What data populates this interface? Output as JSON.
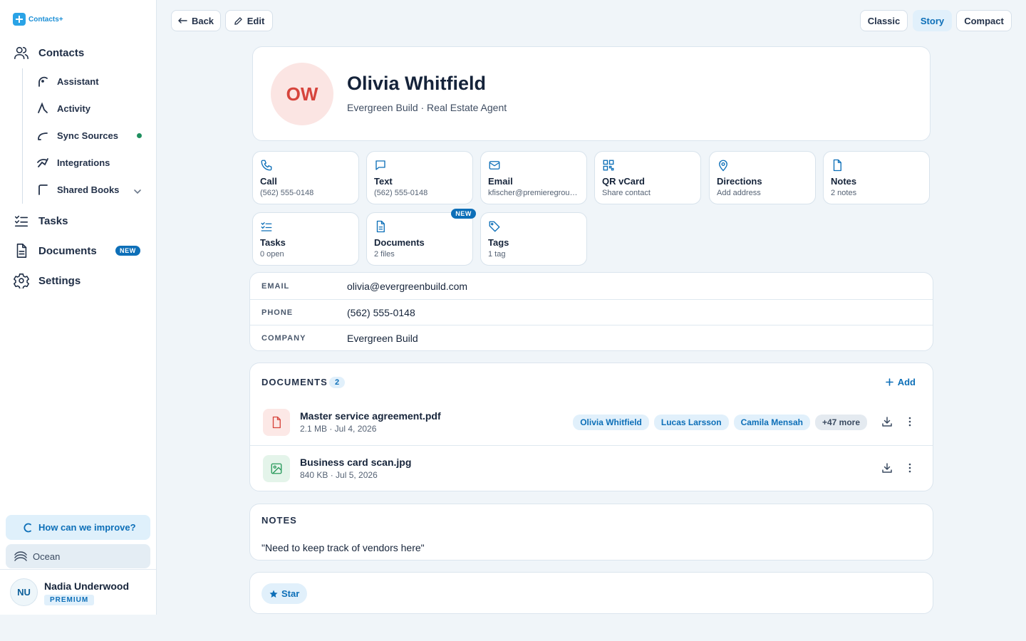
{
  "app": {
    "name": "Contacts+"
  },
  "sidebar": {
    "contacts": "Contacts",
    "sub_items": [
      {
        "label": "Assistant"
      },
      {
        "label": "Activity"
      },
      {
        "label": "Sync Sources"
      },
      {
        "label": "Integrations"
      },
      {
        "label": "Shared Books"
      }
    ],
    "tasks": "Tasks",
    "documents": "Documents",
    "documents_badge": "NEW",
    "settings": "Settings",
    "improve": "How can we improve?",
    "theme": "Ocean",
    "user": {
      "initials": "NU",
      "name": "Nadia Underwood",
      "plan": "PREMIUM"
    }
  },
  "toolbar": {
    "back": "Back",
    "edit": "Edit",
    "views": [
      "Classic",
      "Story",
      "Compact"
    ],
    "active_view": "Story"
  },
  "contact": {
    "initials": "OW",
    "name": "Olivia Whitfield",
    "subtitle": "Evergreen Build · Real Estate Agent"
  },
  "actions": [
    {
      "label": "Call",
      "sub": "(562) 555-0148",
      "icon": "phone-icon"
    },
    {
      "label": "Text",
      "sub": "(562) 555-0148",
      "icon": "message-icon"
    },
    {
      "label": "Email",
      "sub": "kfischer@premieregroup.com",
      "icon": "mail-icon"
    },
    {
      "label": "QR vCard",
      "sub": "Share contact",
      "icon": "qr-icon"
    },
    {
      "label": "Directions",
      "sub": "Add address",
      "icon": "map-pin-icon"
    },
    {
      "label": "Notes",
      "sub": "2 notes",
      "icon": "note-icon"
    },
    {
      "label": "Tasks",
      "sub": "0 open",
      "icon": "checklist-icon"
    },
    {
      "label": "Documents",
      "sub": "2 files",
      "icon": "document-icon",
      "badge": "NEW"
    },
    {
      "label": "Tags",
      "sub": "1 tag",
      "icon": "tag-icon"
    }
  ],
  "info": [
    {
      "key": "EMAIL",
      "value": "olivia@evergreenbuild.com"
    },
    {
      "key": "PHONE",
      "value": "(562) 555-0148"
    },
    {
      "key": "COMPANY",
      "value": "Evergreen Build"
    }
  ],
  "documents": {
    "title": "DOCUMENTS",
    "count": "2",
    "add": "Add",
    "files": [
      {
        "name": "Master service agreement.pdf",
        "meta": "2.1 MB · Jul 4, 2026",
        "type": "pdf",
        "chips": [
          "Olivia Whitfield",
          "Lucas Larsson",
          "Camila Mensah"
        ],
        "more": "+47 more"
      },
      {
        "name": "Business card scan.jpg",
        "meta": "840 KB · Jul 5, 2026",
        "type": "image"
      }
    ]
  },
  "notes": {
    "title": "NOTES",
    "text": "\"Need to keep track of vendors here\""
  },
  "star": {
    "label": "Star"
  },
  "colors": {
    "accent": "#0d6fb8",
    "brand": "#2aa3e6",
    "avatar_bg": "#fbe5e3",
    "avatar_text": "#d6443c",
    "online": "#1f8f5f"
  }
}
